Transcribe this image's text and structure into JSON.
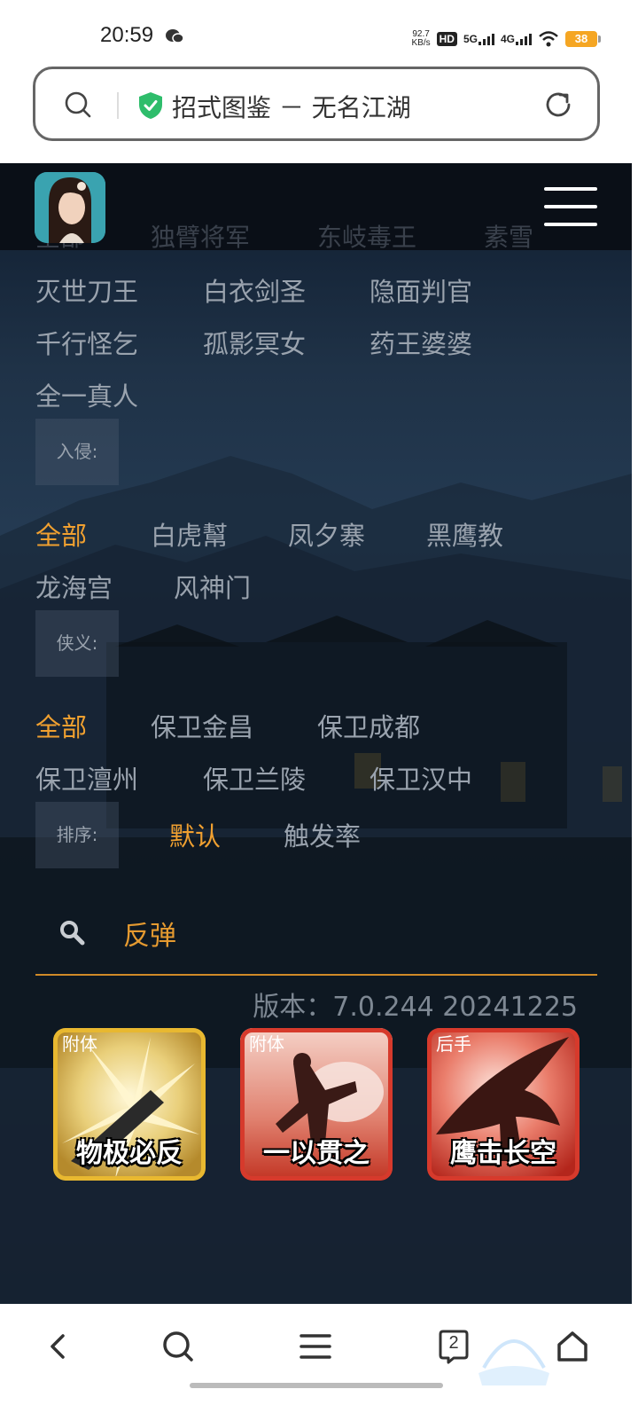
{
  "status_bar": {
    "time": "20:59",
    "net_speed_value": "92.7",
    "net_speed_unit": "KB/s",
    "hd_badge": "HD",
    "net1": "5G",
    "net2": "4G",
    "battery": "38"
  },
  "browser": {
    "page_title": "招式图鉴 － 无名江湖",
    "tab_count": "2"
  },
  "header": {
    "ghost_row": [
      "全部",
      "独臂将军",
      "东岐毒王",
      "素雪"
    ]
  },
  "boss_options": [
    [
      "灭世刀王",
      "白衣剑圣",
      "隐面判官"
    ],
    [
      "千行怪乞",
      "孤影冥女",
      "药王婆婆"
    ],
    [
      "全一真人"
    ]
  ],
  "invasion": {
    "label": "入侵:",
    "options": [
      [
        "全部",
        "白虎幫",
        "凤夕寨",
        "黑鹰教"
      ],
      [
        "龙海宫",
        "风神门"
      ]
    ]
  },
  "chivalry": {
    "label": "侠义:",
    "options": [
      [
        "全部",
        "保卫金昌",
        "保卫成都"
      ],
      [
        "保卫澶州",
        "保卫兰陵",
        "保卫汉中"
      ]
    ]
  },
  "sort": {
    "label": "排序:",
    "options": [
      "默认",
      "触发率"
    ]
  },
  "search": {
    "value": "反弹"
  },
  "version_text": "版本：7.0.244 20241225",
  "cards": [
    {
      "name": "物极必反",
      "tag": "附体",
      "frame_color": "#e8b830"
    },
    {
      "name": "一以贯之",
      "tag": "附体",
      "frame_color": "#d63a2c"
    },
    {
      "name": "鹰击长空",
      "tag": "后手",
      "frame_color": "#d63a2c"
    }
  ],
  "colors": {
    "accent": "#f0a030",
    "inactive_text": "#9aa3ae"
  }
}
